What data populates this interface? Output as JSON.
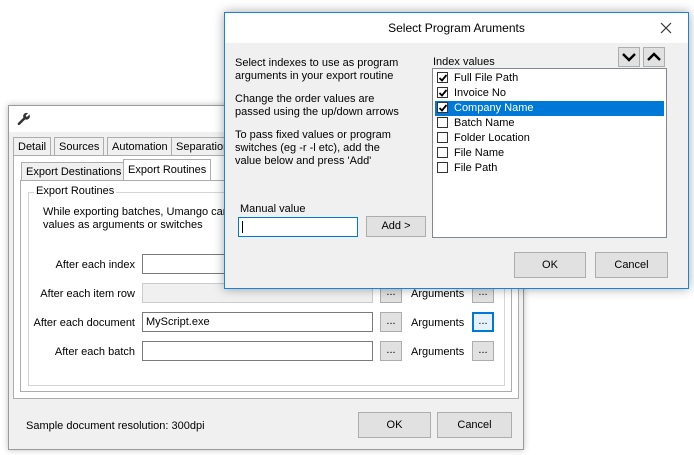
{
  "back_window": {
    "tabs": [
      "Detail",
      "Sources",
      "Automation",
      "Separation"
    ],
    "subtabs": [
      "Export Destinations",
      "Export Routines"
    ],
    "group_title": "Export Routines",
    "description_line1": "While exporting batches, Umango can",
    "description_line2": "values as arguments or switches",
    "rows": [
      {
        "label": "After each index",
        "value": "",
        "args_label": "",
        "disabled": false
      },
      {
        "label": "After each item row",
        "value": "",
        "args_label": "Arguments",
        "disabled": true
      },
      {
        "label": "After each document",
        "value": "MyScript.exe",
        "args_label": "Arguments",
        "disabled": false
      },
      {
        "label": "After each batch",
        "value": "",
        "args_label": "Arguments",
        "disabled": false
      }
    ],
    "browse_label": "...",
    "resolution_text": "Sample document resolution: 300dpi",
    "ok_label": "OK",
    "cancel_label": "Cancel"
  },
  "dialog": {
    "title": "Select Program Aruments",
    "instructions_1_line1": "Select indexes to use as program",
    "instructions_1_line2": "arguments in your export routine",
    "instructions_2_line1": "Change the order values are",
    "instructions_2_line2": "passed using the up/down arrows",
    "instructions_3_line1": "To pass fixed values or program",
    "instructions_3_line2": "switches (eg -r -l etc), add the",
    "instructions_3_line3": "value below and press 'Add'",
    "manual_value_label": "Manual value",
    "manual_value": "",
    "add_label": "Add >",
    "index_values_label": "Index values",
    "index_values": [
      {
        "label": "Full File Path",
        "checked": true,
        "selected": false
      },
      {
        "label": "Invoice No",
        "checked": true,
        "selected": false
      },
      {
        "label": "Company Name",
        "checked": true,
        "selected": true
      },
      {
        "label": "Batch Name",
        "checked": false,
        "selected": false
      },
      {
        "label": "Folder Location",
        "checked": false,
        "selected": false
      },
      {
        "label": "File Name",
        "checked": false,
        "selected": false
      },
      {
        "label": "File Path",
        "checked": false,
        "selected": false
      }
    ],
    "ok_label": "OK",
    "cancel_label": "Cancel",
    "icons": {
      "close": "close-icon",
      "move_down": "chevron-down-icon",
      "move_up": "chevron-up-icon"
    }
  },
  "colors": {
    "selection": "#0078d7",
    "focus_border": "#0078d7"
  }
}
